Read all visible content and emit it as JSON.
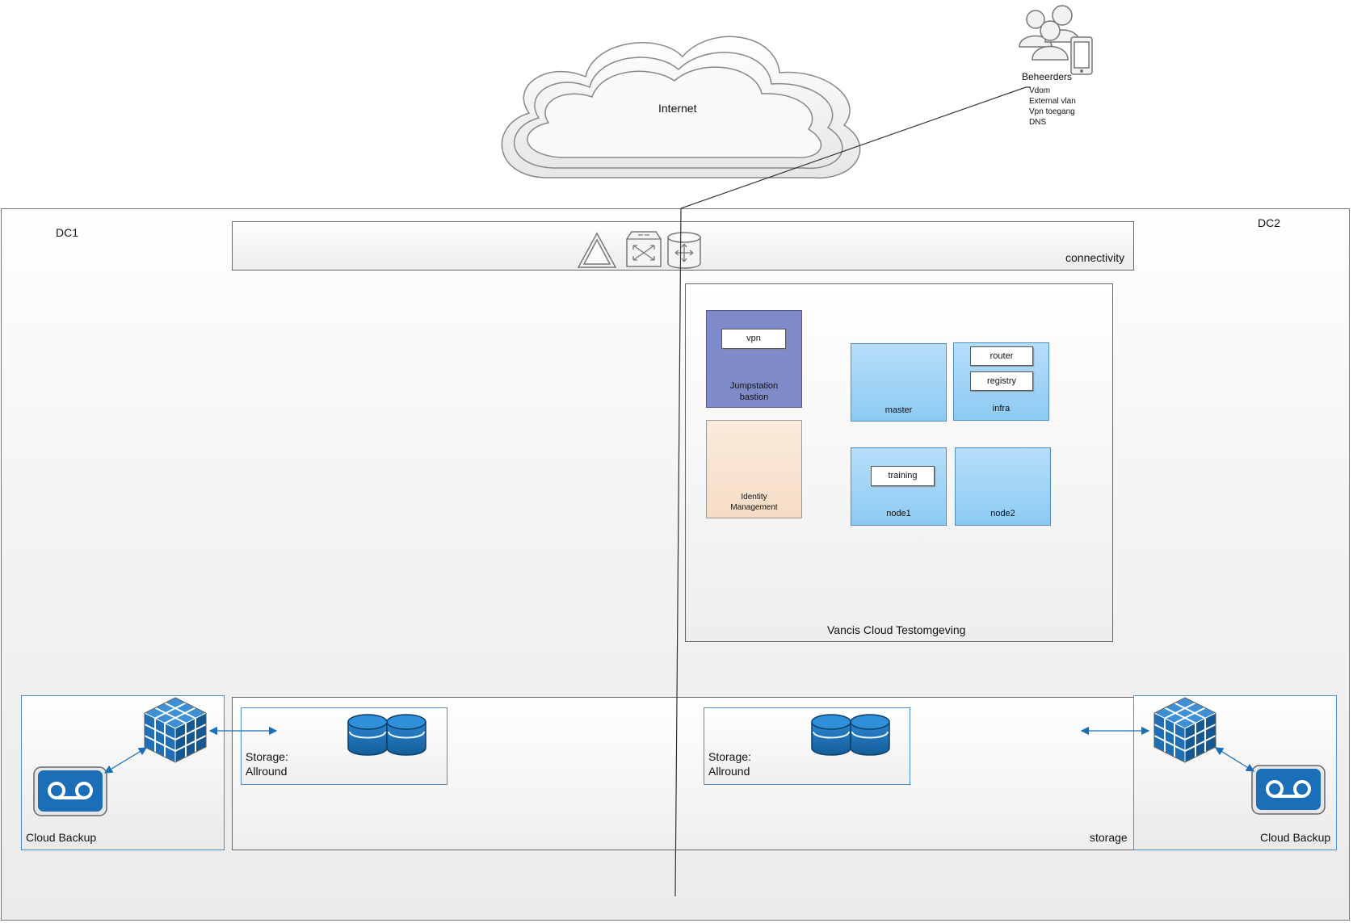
{
  "cloud": {
    "label": "Internet"
  },
  "admins": {
    "label": "Beheerders",
    "notes": [
      "Vdom",
      "External vlan",
      "Vpn toegang",
      "DNS"
    ]
  },
  "dc1": {
    "label": "DC1"
  },
  "dc2": {
    "label": "DC2"
  },
  "connectivity": {
    "label": "connectivity"
  },
  "vancis": {
    "label": "Vancis Cloud Testomgeving",
    "jumpstation": {
      "chip": "vpn",
      "label_line1": "Jumpstation",
      "label_line2": "bastion"
    },
    "identity": {
      "label_line1": "Identity",
      "label_line2": "Management"
    },
    "master": {
      "label": "master"
    },
    "infra": {
      "label": "infra",
      "chips": [
        "router",
        "registry"
      ]
    },
    "node1": {
      "label": "node1",
      "chip": "training"
    },
    "node2": {
      "label": "node2"
    }
  },
  "storage": {
    "label": "storage",
    "left_store": {
      "line1": "Storage:",
      "line2": "Allround"
    },
    "right_store": {
      "line1": "Storage:",
      "line2": "Allround"
    }
  },
  "backup_left": {
    "label": "Cloud Backup"
  },
  "backup_right": {
    "label": "Cloud Backup"
  },
  "colors": {
    "jumpstation": "#7f8bc9",
    "identity": "#f8e2cf",
    "node": "#9fd3f7",
    "icon_blue": "#1c6fb5"
  }
}
